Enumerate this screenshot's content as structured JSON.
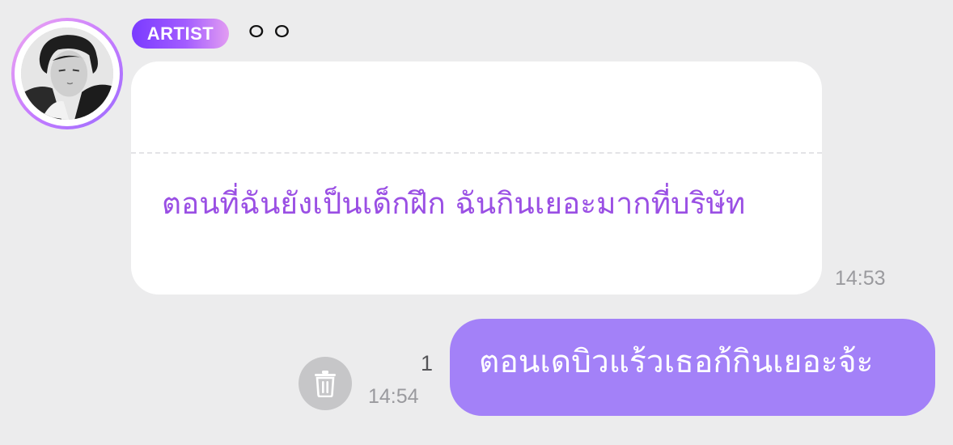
{
  "sender": {
    "badge": "ARTIST",
    "name": "ㅇㅇ",
    "avatar_icon": "profile-photo"
  },
  "messages": [
    {
      "direction": "incoming",
      "text": "ตอนที่ฉันยังเป็นเด็กฝึก ฉันกินเยอะมากที่บริษัท",
      "time": "14:53"
    },
    {
      "direction": "outgoing",
      "text": "ตอนเดบิวแร้วเธอก้กินเยอะจ้ะ",
      "time": "14:54",
      "read_count": "1",
      "action_icon": "trash-icon"
    }
  ],
  "colors": {
    "background": "#ececed",
    "incoming_text": "#9a4fe4",
    "outgoing_bubble": "#a381f8",
    "badge_gradient_start": "#7a3bff",
    "badge_gradient_end": "#e29cf2"
  }
}
